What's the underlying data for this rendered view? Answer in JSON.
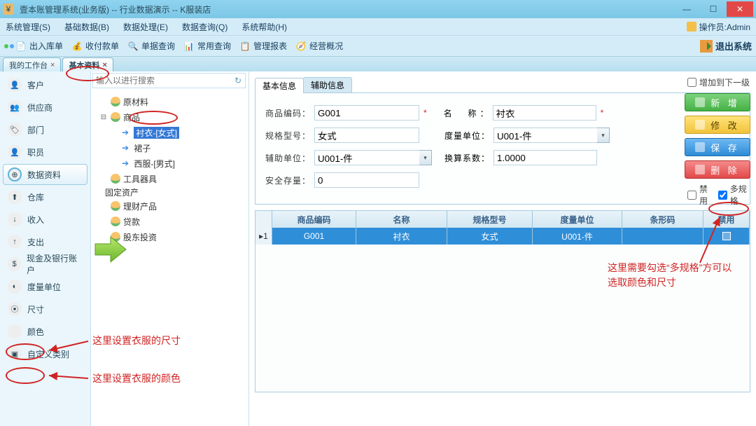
{
  "window": {
    "title": "壹本账管理系统(业务版) -- 行业数据演示 -- K服装店"
  },
  "operator": {
    "label": "操作员:Admin"
  },
  "menu": [
    "系统管理(S)",
    "基础数据(B)",
    "数据处理(E)",
    "数据查询(Q)",
    "系统帮助(H)"
  ],
  "toolbar": {
    "items": [
      "出入库单",
      "收付款单",
      "单据查询",
      "常用查询",
      "管理报表",
      "经营概况"
    ],
    "exit": "退出系统"
  },
  "tabs": {
    "workbench": "我的工作台",
    "basic": "基本资料"
  },
  "sidebar": [
    "客户",
    "供应商",
    "部门",
    "职员",
    "数据资料",
    "仓库",
    "收入",
    "支出",
    "现金及银行账户",
    "度量单位",
    "尺寸",
    "颜色",
    "自定义类别"
  ],
  "search": {
    "placeholder": "输入以进行搜索"
  },
  "tree": {
    "raw": "原材料",
    "goods": "商品",
    "item1": "衬衣-[女式]",
    "item2": "裙子",
    "item3": "西服-[男式]",
    "tools": "工具器具",
    "fixed": "固定资产",
    "fin": "理财产品",
    "loan": "贷款",
    "inv": "股东投资"
  },
  "formtabs": {
    "basic": "基本信息",
    "aux": "辅助信息"
  },
  "form": {
    "l_code": "商品编码：",
    "v_code": "G001",
    "l_name": "名　称：",
    "v_name": "衬衣",
    "l_spec": "规格型号：",
    "v_spec": "女式",
    "l_unit": "度量单位：",
    "v_unit": "U001-件",
    "l_aux": "辅助单位：",
    "v_aux": "U001-件",
    "l_rate": "换算系数：",
    "v_rate": "1.0000",
    "l_safe": "安全存量：",
    "v_safe": "0"
  },
  "checks": {
    "addnext": "增加到下一级",
    "disable": "禁用",
    "multispec": "多规格"
  },
  "buttons": {
    "add": "新 增",
    "edit": "修 改",
    "save": "保 存",
    "del": "删 除"
  },
  "grid": {
    "headers": [
      "商品编码",
      "名称",
      "规格型号",
      "度量单位",
      "条形码",
      "禁用"
    ],
    "row": {
      "idx": "1",
      "code": "G001",
      "name": "衬衣",
      "spec": "女式",
      "unit": "U001-件",
      "bar": "",
      "dis": ""
    }
  },
  "annotations": {
    "a1": "这里设置衣服的尺寸",
    "a2": "这里设置衣服的颜色",
    "a3": "这里需要勾选“多规格”方可以选取颜色和尺寸"
  }
}
